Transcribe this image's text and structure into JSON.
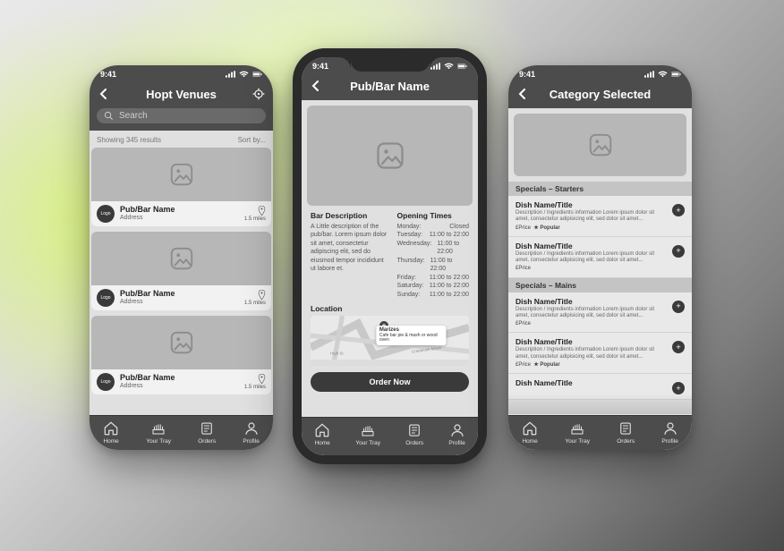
{
  "status": {
    "time": "9:41"
  },
  "tabbar": [
    "Home",
    "Your Tray",
    "Orders",
    "Profile"
  ],
  "venue_logo_text": "Logo",
  "screen1": {
    "title": "Hopt Venues",
    "search_placeholder": "Search",
    "results_text": "Showing 345 results",
    "sort_label": "Sort by...",
    "venues": [
      {
        "name": "Pub/Bar Name",
        "address": "Address",
        "distance": "1.5 miles"
      },
      {
        "name": "Pub/Bar Name",
        "address": "Address",
        "distance": "1.5 miles"
      },
      {
        "name": "Pub/Bar Name",
        "address": "Address",
        "distance": "1.5 miles"
      }
    ]
  },
  "screen2": {
    "title": "Pub/Bar Name",
    "desc_heading": "Bar Description",
    "desc_text": "A Little description of the pub/bar. Lorem ipsum dolor sit amet, consectetur adipiscing elit, sed do eiusmod tempor incididunt ut labore et.",
    "hours_heading": "Opening Times",
    "hours": [
      {
        "day": "Monday",
        "time": "Closed"
      },
      {
        "day": "Tuesday",
        "time": "11:00 to 22:00"
      },
      {
        "day": "Wednesday",
        "time": "11:00 to 22:00"
      },
      {
        "day": "Thursday",
        "time": "11:00 to 22:00"
      },
      {
        "day": "Friday",
        "time": "11:00 to 22:00"
      },
      {
        "day": "Saturday",
        "time": "11:00 to 22:00"
      },
      {
        "day": "Sunday",
        "time": "11:00 to 22:00"
      }
    ],
    "location_heading": "Location",
    "map_pin": {
      "title": "Marizes",
      "subtitle": "Cafe bar pie & mash or wood oven"
    },
    "order_label": "Order Now"
  },
  "screen3": {
    "title": "Category Selected",
    "sections": [
      {
        "heading": "Specials – Starters",
        "items": [
          {
            "name": "Dish Name/Title",
            "desc": "Description / Ingredients information Lorem ipsum dolor sit amet, consectetur adipisicing elit, sed dolor sit amet...",
            "price": "£Price",
            "popular": true
          },
          {
            "name": "Dish Name/Title",
            "desc": "Description / Ingredients information Lorem ipsum dolor sit amet, consectetur adipisicing elit, sed dolor sit amet...",
            "price": "£Price",
            "popular": false
          }
        ]
      },
      {
        "heading": "Specials – Mains",
        "items": [
          {
            "name": "Dish Name/Title",
            "desc": "Description / Ingredients information Lorem ipsum dolor sit amet, consectetur adipisicing elit, sed dolor sit amet...",
            "price": "£Price",
            "popular": false
          },
          {
            "name": "Dish Name/Title",
            "desc": "Description / Ingredients information Lorem ipsum dolor sit amet, consectetur adipisicing elit, sed dolor sit amet...",
            "price": "£Price",
            "popular": true
          },
          {
            "name": "Dish Name/Title",
            "desc": "",
            "price": "",
            "popular": false
          }
        ]
      }
    ]
  }
}
